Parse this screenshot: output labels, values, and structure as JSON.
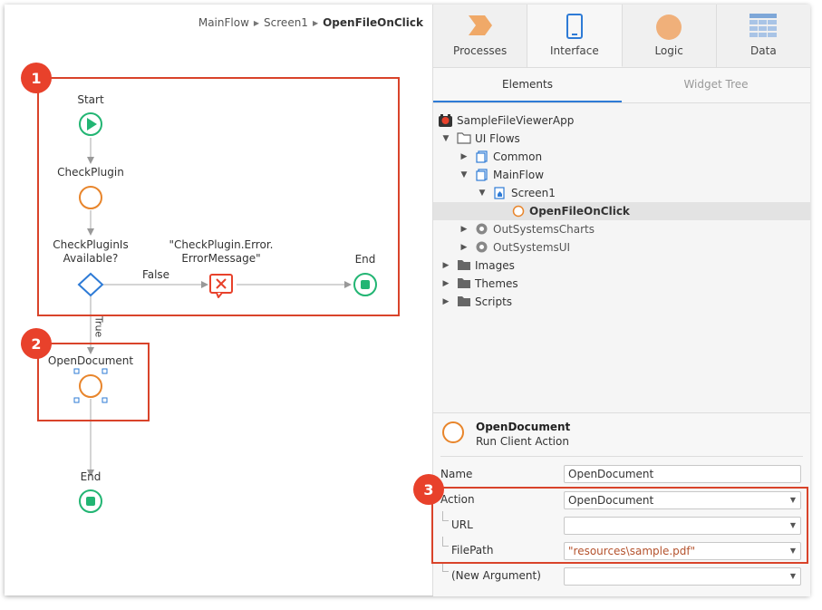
{
  "breadcrumb": {
    "items": [
      "MainFlow",
      "Screen1"
    ],
    "current": "OpenFileOnClick"
  },
  "flow": {
    "start_label": "Start",
    "check_plugin_label": "CheckPlugin",
    "if_label_line1": "CheckPluginIs",
    "if_label_line2": "Available?",
    "false_label": "False",
    "true_label": "True",
    "exception_label_line1": "\"CheckPlugin.Error.",
    "exception_label_line2": "ErrorMessage\"",
    "end_label_1": "End",
    "open_document_label": "OpenDocument",
    "end_label_2": "End"
  },
  "badges": [
    "1",
    "2",
    "3"
  ],
  "tabs": [
    {
      "label": "Processes",
      "icon": "processes-icon"
    },
    {
      "label": "Interface",
      "icon": "mobile-phone-icon"
    },
    {
      "label": "Logic",
      "icon": "logic-circle-icon"
    },
    {
      "label": "Data",
      "icon": "data-grid-icon"
    }
  ],
  "active_tab": "Interface",
  "subtabs": [
    "Elements",
    "Widget Tree"
  ],
  "active_subtab": "Elements",
  "tree": [
    {
      "label": "SampleFileViewerApp",
      "icon": "app-icon"
    },
    {
      "label": "UI Flows",
      "icon": "folder-icon"
    },
    {
      "label": "Common",
      "icon": "flow-icon"
    },
    {
      "label": "MainFlow",
      "icon": "flow-icon"
    },
    {
      "label": "Screen1",
      "icon": "screen-icon"
    },
    {
      "label": "OpenFileOnClick",
      "icon": "client-action-icon"
    },
    {
      "label": "OutSystemsCharts",
      "icon": "module-icon"
    },
    {
      "label": "OutSystemsUI",
      "icon": "module-icon"
    },
    {
      "label": "Images",
      "icon": "folder-icon"
    },
    {
      "label": "Themes",
      "icon": "folder-icon"
    },
    {
      "label": "Scripts",
      "icon": "folder-icon"
    }
  ],
  "properties": {
    "name": "OpenDocument",
    "type": "Run Client Action",
    "rows": [
      {
        "label": "Name",
        "value": "OpenDocument"
      },
      {
        "label": "Action",
        "value": "OpenDocument"
      },
      {
        "label": "URL",
        "value": ""
      },
      {
        "label": "FilePath",
        "value": "\"resources\\sample.pdf\""
      },
      {
        "label": "(New Argument)",
        "value": ""
      }
    ]
  },
  "colors": {
    "accent_blue": "#2e7bd6",
    "start_green": "#22b573",
    "action_orange": "#e8852b",
    "annotation_red": "#e8412b",
    "exception_red": "#e8412b"
  }
}
